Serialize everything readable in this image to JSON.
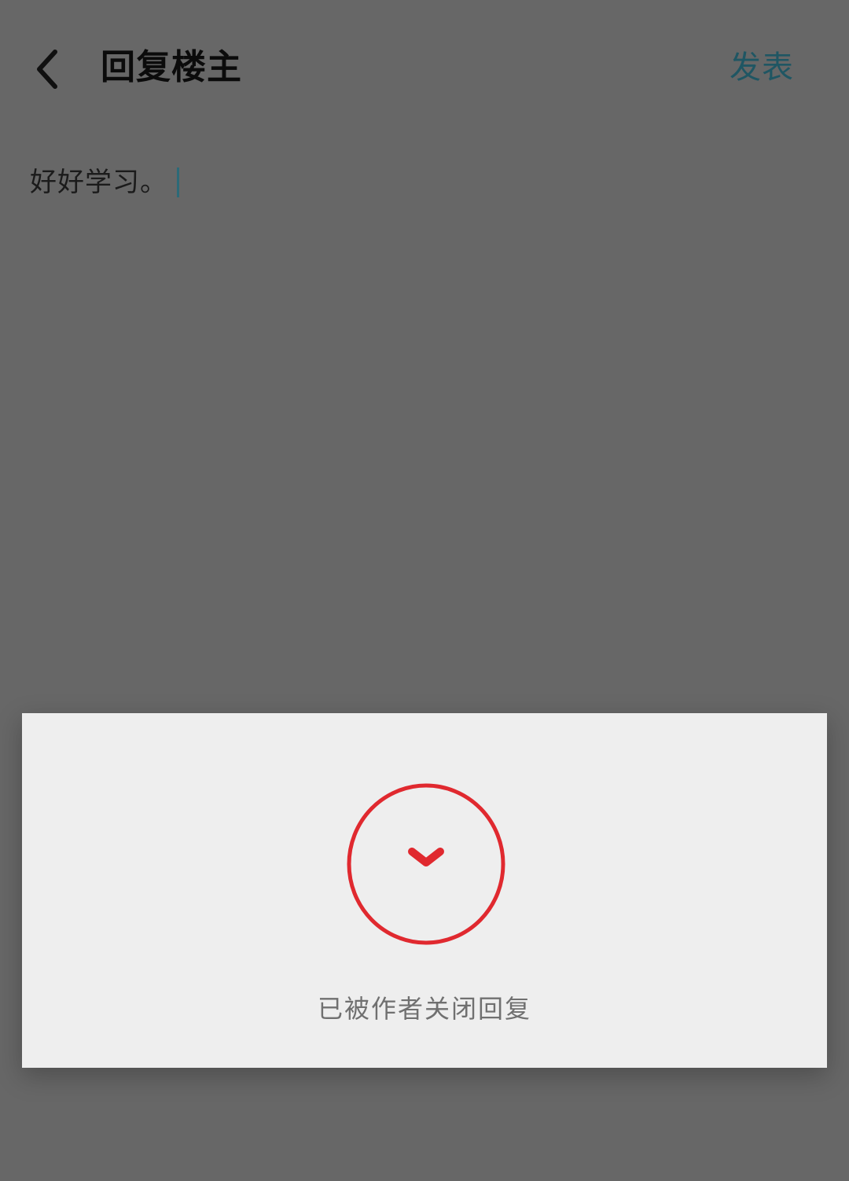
{
  "header": {
    "title": "回复楼主",
    "post_label": "发表",
    "back_icon": "chevron-left-icon"
  },
  "editor": {
    "value": "好好学习。"
  },
  "dialog": {
    "message": "已被作者关闭回复",
    "icon": "chevron-down-circle-icon",
    "icon_color": "#e0292f"
  },
  "colors": {
    "overlay_background": "#676767",
    "dialog_background": "#eeeeee",
    "accent": "#1f5663",
    "caret": "#2b6a78",
    "error": "#e0292f"
  }
}
